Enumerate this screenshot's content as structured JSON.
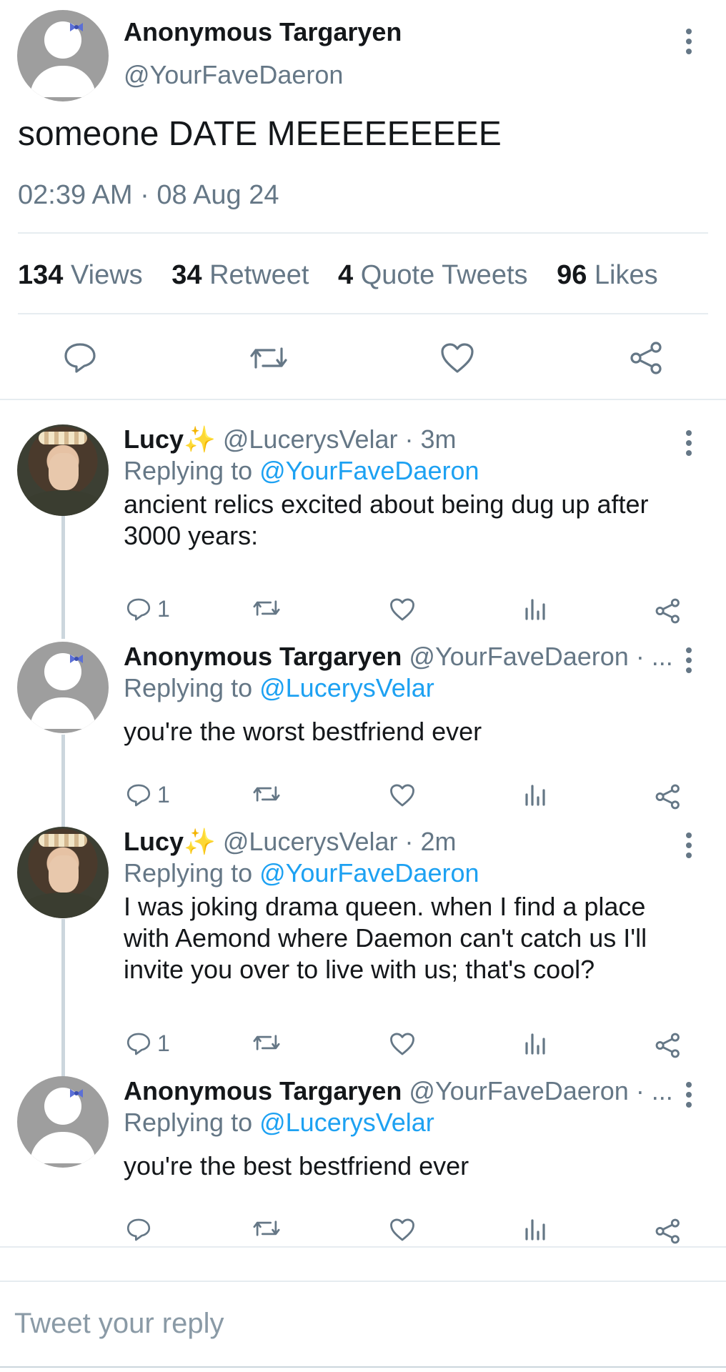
{
  "main_tweet": {
    "name": "Anonymous Targaryen",
    "handle": "@YourFaveDaeron",
    "text": "someone DATE MEEEEEEEEE",
    "timestamp": "02:39 AM · 08 Aug 24",
    "stats": [
      {
        "value": "134",
        "label": "Views"
      },
      {
        "value": "34",
        "label": "Retweet"
      },
      {
        "value": "4",
        "label": "Quote Tweets"
      },
      {
        "value": "96",
        "label": "Likes"
      }
    ],
    "actions": [
      "reply-icon",
      "retweet-icon",
      "like-icon",
      "share-icon"
    ]
  },
  "replies": [
    {
      "name": "Lucy✨",
      "meta": " @LucerysVelar · 3m",
      "replying_prefix": "Replying to ",
      "replying_to": "@YourFaveDaeron",
      "text": "ancient relics excited about being dug up after 3000 years:",
      "reply_count": "1",
      "avatar": "photo"
    },
    {
      "name": "Anonymous Targaryen",
      "meta": " @YourFaveDaeron · ...",
      "replying_prefix": "Replying to ",
      "replying_to": "@LucerysVelar",
      "text": "you're the worst bestfriend ever",
      "reply_count": "1",
      "avatar": "default"
    },
    {
      "name": "Lucy✨",
      "meta": " @LucerysVelar · 2m",
      "replying_prefix": "Replying to ",
      "replying_to": "@YourFaveDaeron",
      "text": "I was joking drama queen. when I find a place with Aemond where Daemon can't catch us I'll invite you over to live with us; that's cool?",
      "reply_count": "1",
      "avatar": "photo"
    },
    {
      "name": "Anonymous Targaryen",
      "meta": " @YourFaveDaeron · ...",
      "replying_prefix": "Replying to ",
      "replying_to": "@LucerysVelar",
      "text": "you're the best bestfriend ever",
      "reply_count": "",
      "avatar": "default"
    }
  ],
  "reply_box": {
    "placeholder": "Tweet your reply"
  },
  "colors": {
    "icon_gray": "#657786",
    "link_blue": "#1da1f2",
    "divider": "#e6ecf0"
  }
}
